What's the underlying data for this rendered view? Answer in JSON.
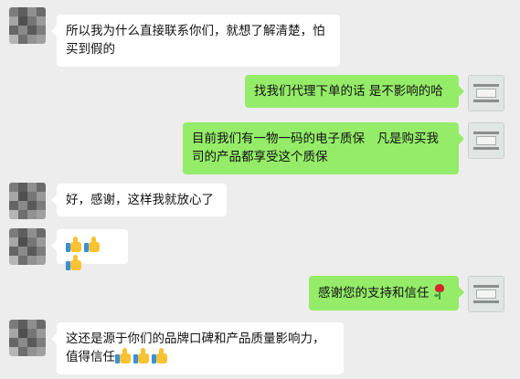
{
  "messages": [
    {
      "side": "left",
      "text": "所以我为什么直接联系你们，就想了解清楚，怕买到假的"
    },
    {
      "side": "right",
      "text": "找我们代理下单的话 是不影响的哈"
    },
    {
      "side": "right",
      "text": "目前我们有一物一码的电子质保　凡是购买我司的产品都享受这个质保"
    },
    {
      "side": "left",
      "text": "好，感谢，这样我就放心了"
    },
    {
      "side": "left",
      "text": "",
      "emoji": [
        "thumbs-up-icon",
        "thumbs-up-icon",
        "thumbs-up-icon"
      ]
    },
    {
      "side": "right",
      "text": "感谢您的支持和信任",
      "emoji": [
        "rose-icon"
      ]
    },
    {
      "side": "left",
      "text": "这还是源于你们的品牌口碑和产品质量影响力，值得信任",
      "emoji": [
        "thumbs-up-icon",
        "thumbs-up-icon",
        "thumbs-up-icon"
      ]
    }
  ],
  "colors": {
    "background": "#ededed",
    "incoming_bubble": "#ffffff",
    "outgoing_bubble": "#95ec69",
    "thumb_yellow": "#f7c233",
    "thumb_cuff": "#3d8fd6",
    "rose_red": "#d6242a"
  }
}
